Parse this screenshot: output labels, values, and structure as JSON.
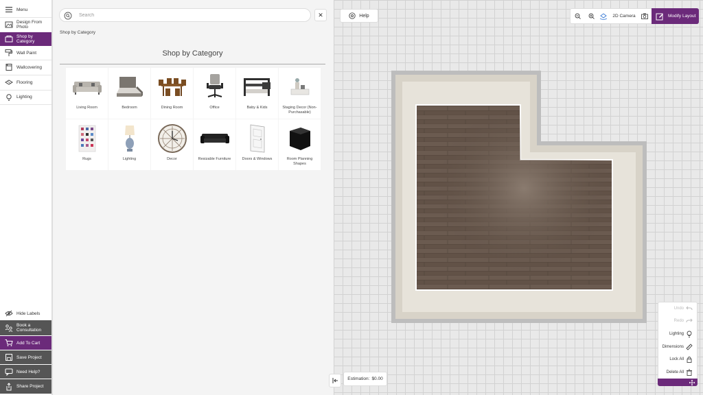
{
  "sidebar": {
    "menu_label": "Menu",
    "items": [
      {
        "label": "Design From Photo",
        "icon": "photo-design-icon"
      },
      {
        "label": "Shop by Category",
        "icon": "shop-category-icon"
      },
      {
        "label": "Wall Paint",
        "icon": "paint-roller-icon"
      },
      {
        "label": "Wallcovering",
        "icon": "wallcovering-icon"
      },
      {
        "label": "Flooring",
        "icon": "flooring-icon"
      },
      {
        "label": "Lighting",
        "icon": "lightbulb-icon"
      }
    ],
    "bottom": [
      {
        "label": "Hide Labels",
        "icon": "eye-slash-icon"
      },
      {
        "label": "Book a Consultation",
        "icon": "consultation-icon"
      },
      {
        "label": "Add To Cart",
        "icon": "cart-icon"
      },
      {
        "label": "Save Project",
        "icon": "save-icon"
      },
      {
        "label": "Need Help?",
        "icon": "chat-icon"
      },
      {
        "label": "Share Project",
        "icon": "share-icon"
      }
    ]
  },
  "search": {
    "placeholder": "Search"
  },
  "breadcrumb": "Shop by Category",
  "catalog": {
    "title": "Shop by Category",
    "categories": [
      {
        "label": "Living Room",
        "icon": "sofa-icon"
      },
      {
        "label": "Bedroom",
        "icon": "bed-icon"
      },
      {
        "label": "Dining Room",
        "icon": "dining-set-icon"
      },
      {
        "label": "Office",
        "icon": "office-chair-icon"
      },
      {
        "label": "Baby & Kids",
        "icon": "bunk-bed-icon"
      },
      {
        "label": "Staging Decor (Non-Purchasable)",
        "icon": "decor-set-icon"
      },
      {
        "label": "Rugs",
        "icon": "rug-icon"
      },
      {
        "label": "Lighting",
        "icon": "table-lamp-icon"
      },
      {
        "label": "Decor",
        "icon": "wall-clock-icon"
      },
      {
        "label": "Resizable Furniture",
        "icon": "black-sofa-icon"
      },
      {
        "label": "Doors & Windows",
        "icon": "door-icon"
      },
      {
        "label": "Room Planning Shapes",
        "icon": "cube-icon"
      }
    ]
  },
  "canvas": {
    "help_label": "Help",
    "camera_label": "2D Camera",
    "modify_label": "Modify Layout",
    "estimation_label": "Estimation:",
    "estimation_value": "$0.00",
    "tools": [
      {
        "label": "Undo",
        "icon": "undo-icon",
        "disabled": true
      },
      {
        "label": "Redo",
        "icon": "redo-icon",
        "disabled": true
      },
      {
        "label": "Lighting",
        "icon": "lighting-icon",
        "disabled": false
      },
      {
        "label": "Dimensions",
        "icon": "ruler-icon",
        "disabled": false
      },
      {
        "label": "Lock All",
        "icon": "lock-icon",
        "disabled": false
      },
      {
        "label": "Delete All",
        "icon": "trash-icon",
        "disabled": false
      }
    ]
  },
  "colors": {
    "accent": "#6b2a7a",
    "dark": "#555555",
    "canvas": "#e9e9e9",
    "floor": "#6a5a4e"
  }
}
